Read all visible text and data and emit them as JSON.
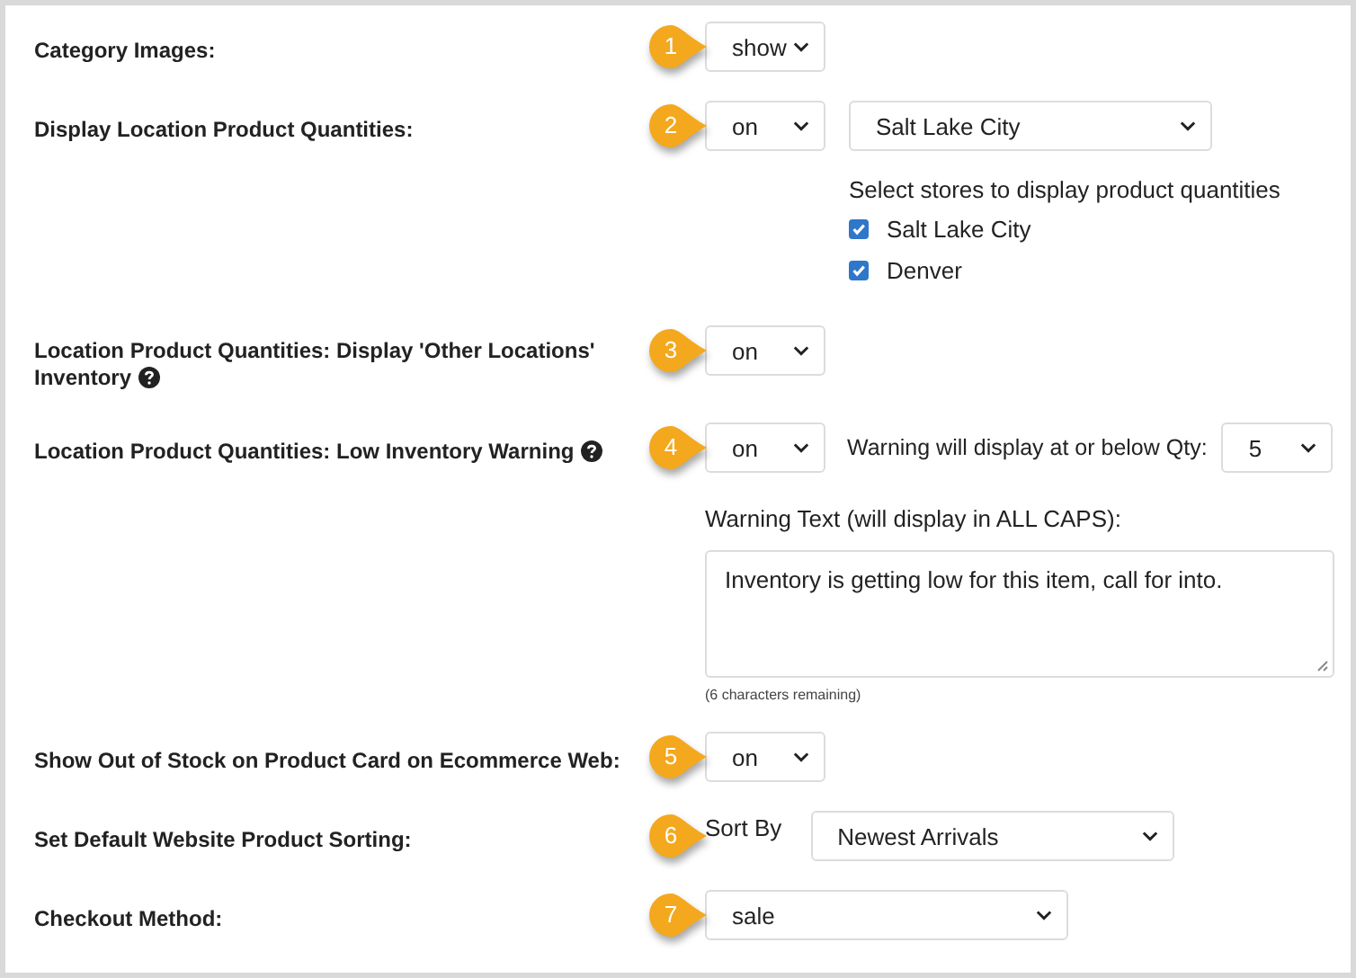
{
  "settings": [
    {
      "kind": "select",
      "label": "Category Images:",
      "help": false,
      "marker": "1",
      "value": "show"
    },
    {
      "kind": "locations",
      "label": "Display Location Product Quantities:",
      "help": false,
      "marker": "2",
      "value": "on",
      "store": "Salt Lake City",
      "stores_prompt": "Select stores to display product quantities",
      "stores": [
        {
          "name": "Salt Lake City",
          "checked": true
        },
        {
          "name": "Denver",
          "checked": true
        }
      ]
    },
    {
      "kind": "select",
      "label": "Location Product Quantities: Display 'Other Locations' Inventory",
      "help": true,
      "marker": "3",
      "value": "on"
    },
    {
      "kind": "low_stock",
      "label": "Location Product Quantities: Low Inventory Warning",
      "help": true,
      "marker": "4",
      "value": "on",
      "qty_label": "Warning will display at or below Qty:",
      "qty": "5",
      "text_label": "Warning Text (will display in ALL CAPS):",
      "text": "Inventory is getting low for this item, call for into.",
      "remaining": "(6 characters remaining)"
    },
    {
      "kind": "select",
      "label": "Show Out of Stock on Product Card on Ecommerce Web:",
      "help": false,
      "marker": "5",
      "value": "on"
    },
    {
      "kind": "sorting",
      "label": "Set Default Website Product Sorting:",
      "help": false,
      "marker": "6",
      "sort_label": "Sort By",
      "value": "Newest Arrivals"
    },
    {
      "kind": "wide_select",
      "label": "Checkout Method:",
      "help": false,
      "marker": "7",
      "value": "sale"
    }
  ]
}
